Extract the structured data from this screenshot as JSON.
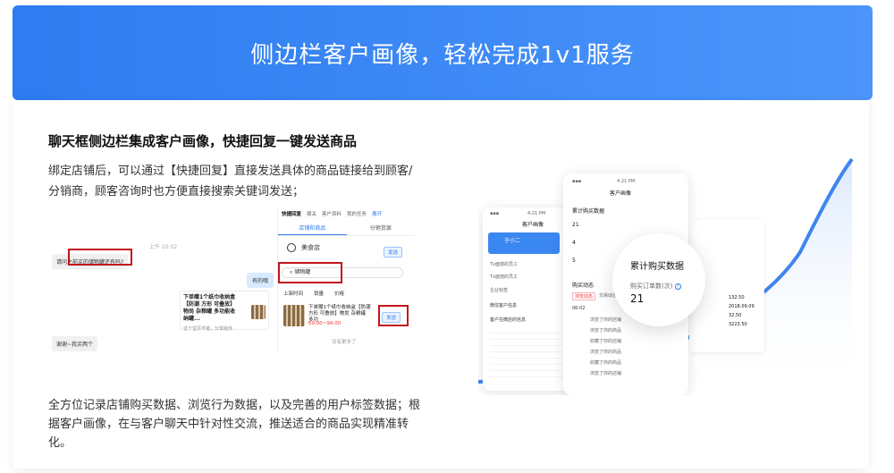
{
  "banner": {
    "title": "侧边栏客户画像，轻松完成1v1服务"
  },
  "section": {
    "heading": "聊天框侧边栏集成客户画像，快捷回复一键发送商品",
    "desc1": "绑定店铺后，可以通过【快捷回复】直接发送具体的商品链接给到顾客/分销商，顾客咨询时也方便直接搜索关键词发送；",
    "desc2": "全方位记录店铺购买数据、浏览行为数据，以及完善的用户标签数据；根据客户画像，在与客户聊天中针对性交流，推送适合的商品实现精准转化。"
  },
  "chat": {
    "time": "上午 10:02",
    "msg_customer": "请问之前买的储物罐还有吗?",
    "msg_agent": "有的哦",
    "product_title": "下单赠1个纸巾收纳盒【防潮 方形 可叠放】物尚 杂粮罐 多功能收纳罐...",
    "product_sub": "这个宝贝不错，分享给你",
    "msg_customer2": "谢谢~我买两个"
  },
  "sidebar": {
    "tabs": [
      "快捷回复",
      "摘关",
      "客户资料",
      "我的任务",
      "展开"
    ],
    "subtabs": [
      "店铺和商品",
      "分销货源"
    ],
    "shop_name": "美食店",
    "send_label": "发送",
    "search_value": "储物罐",
    "filters": [
      "上架时间",
      "销量",
      "价格"
    ],
    "product_title": "下单赠1个纸巾收纳盒【防潮 方形 可叠放】物尚 杂粮罐 多功",
    "product_price": "69.00~94.00",
    "no_more": "没有更多了"
  },
  "phone_front": {
    "time": "4:21 PM",
    "title": "客户画像",
    "section": "累计购买数据",
    "stat_values": [
      "21",
      "4",
      "5"
    ],
    "activity_header": "购买动态",
    "activity_tabs": [
      "浏览动态",
      "交易动态",
      "订单"
    ],
    "date": "06-02",
    "events": [
      "浏览了你的店铺",
      "浏览了你的商品",
      "收藏了你的店铺",
      "浏览了你的商品",
      "收藏了你的商品",
      "浏览了你的店铺"
    ]
  },
  "phone_back": {
    "time": "4:21 PM",
    "title": "客户画像",
    "customer_name": "于小二",
    "rows": [
      "Tx面馆的员工",
      "Tx面馆的员工",
      "企业标签"
    ],
    "section": "微信客户信息",
    "section2": "客户在微店的信息"
  },
  "popup": {
    "title": "累计购买数据",
    "label": "购买订单数(次)",
    "value": "21"
  },
  "data_panel": {
    "values": [
      "132.50",
      "2018.09.09",
      "32.50",
      "3223.50"
    ]
  }
}
